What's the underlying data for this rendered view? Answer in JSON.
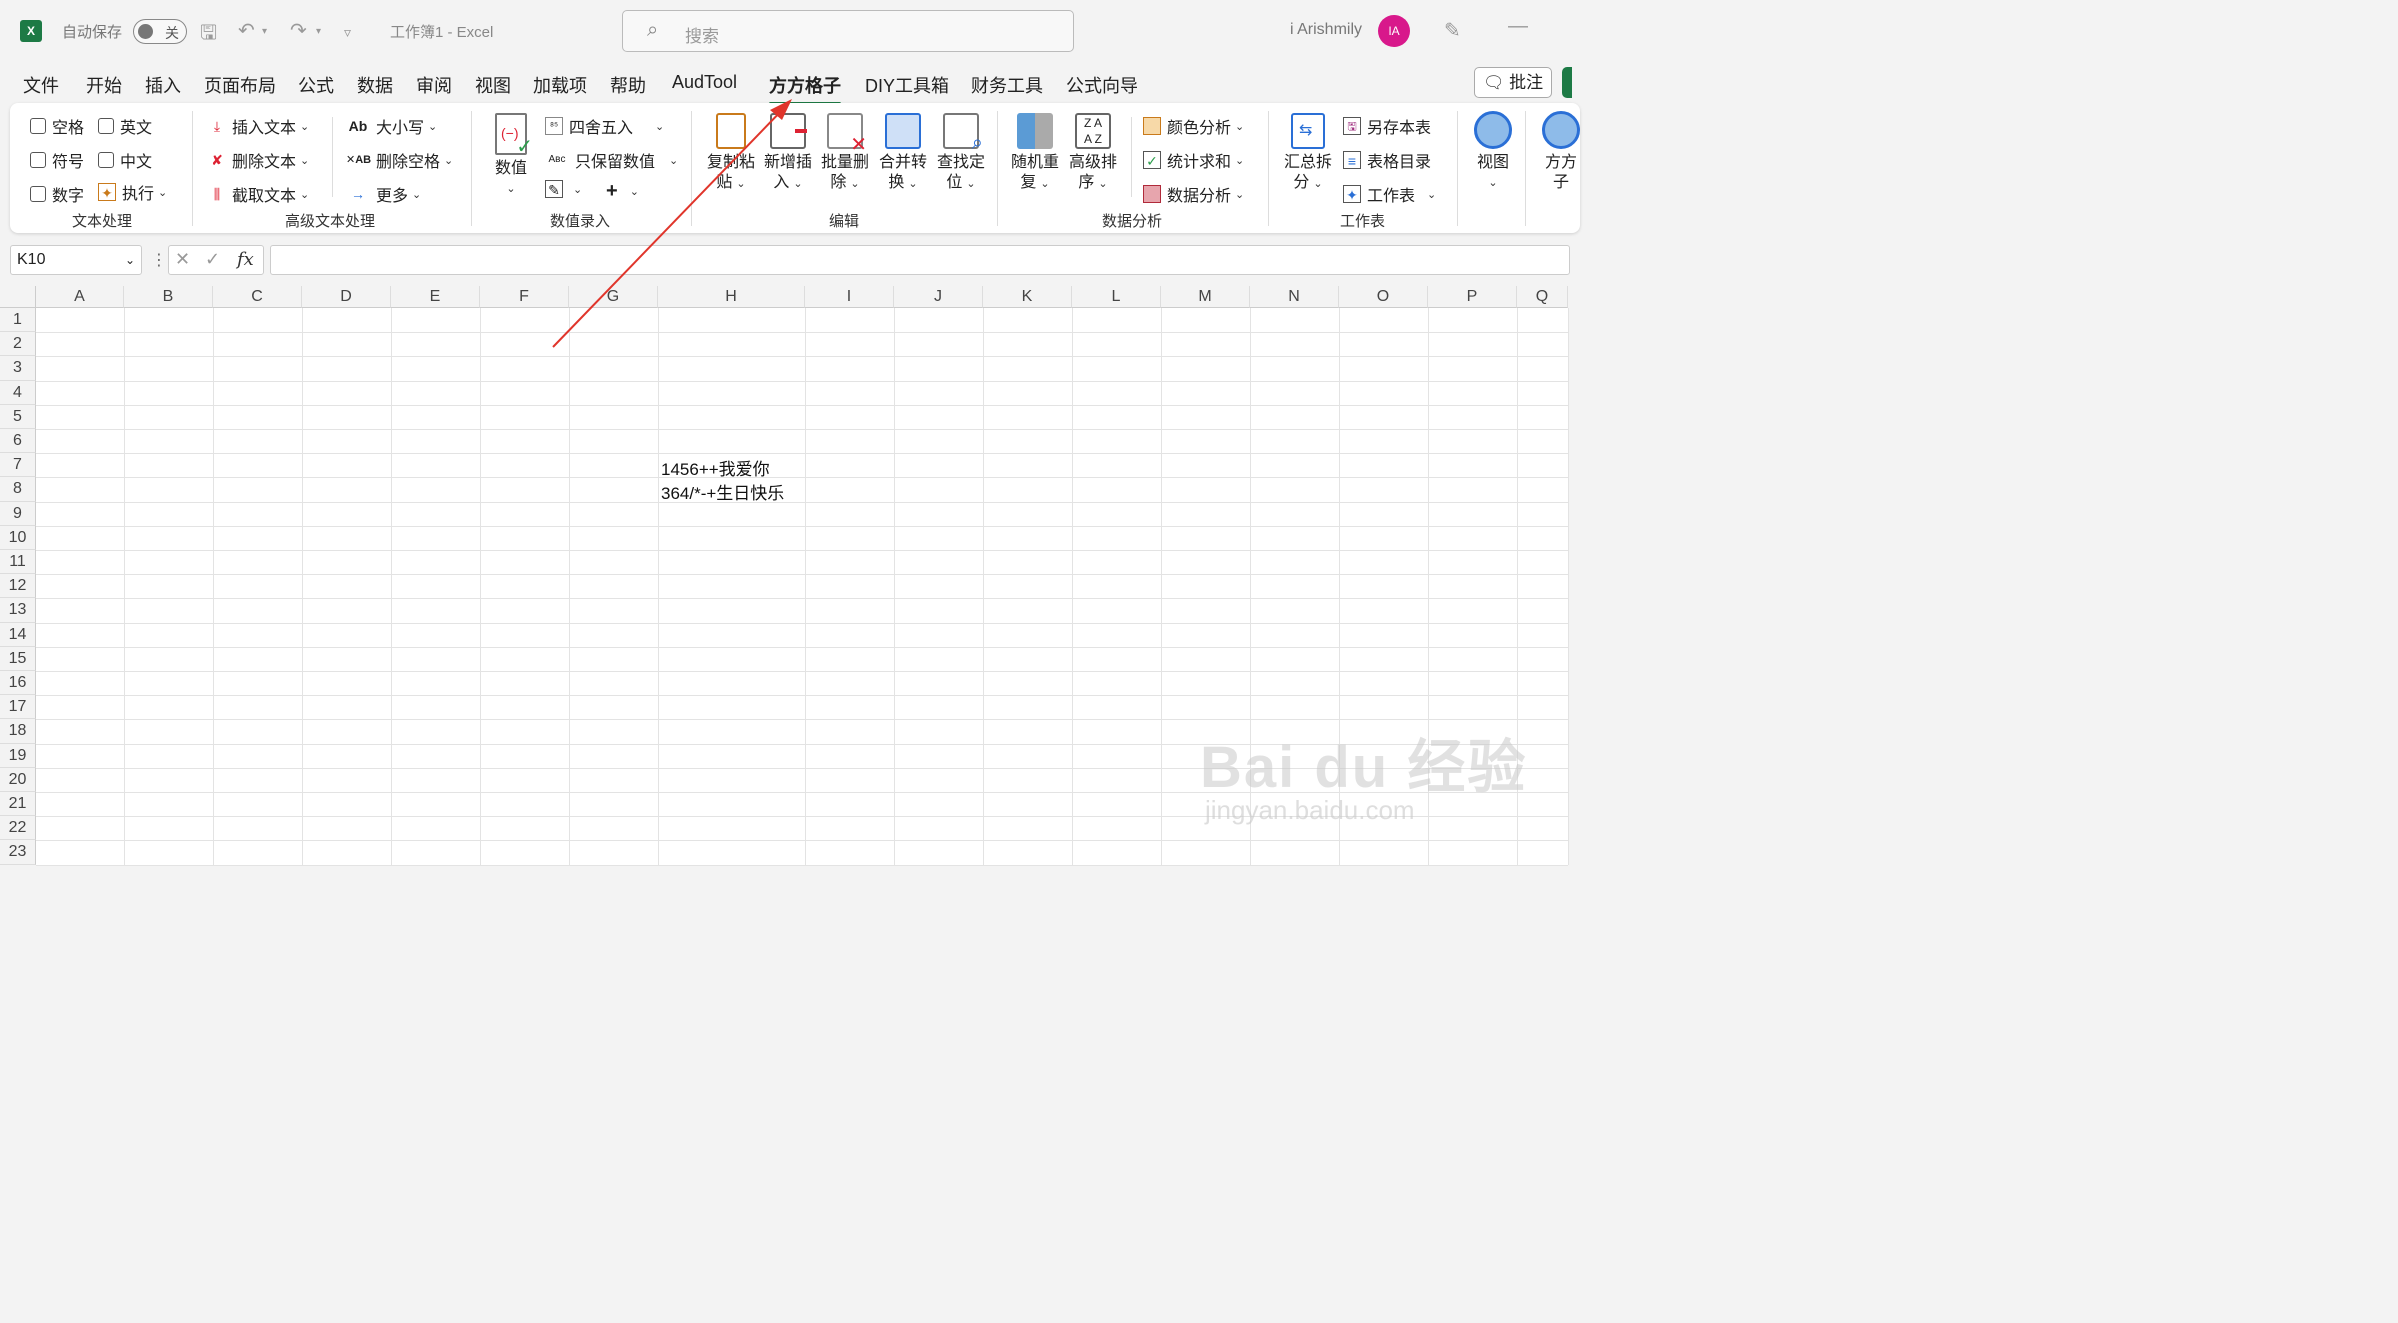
{
  "titlebar": {
    "logo": "X",
    "autosave_label": "自动保存",
    "autosave_state": "关",
    "doc_title": "工作簿1  -  Excel",
    "search_placeholder": "搜索",
    "user_name": "i Arishmily",
    "avatar_initials": "IA"
  },
  "menu": {
    "tabs": [
      "文件",
      "开始",
      "插入",
      "页面布局",
      "公式",
      "数据",
      "审阅",
      "视图",
      "加载项",
      "帮助",
      "AudTool",
      "方方格子",
      "DIY工具箱",
      "财务工具",
      "公式向导"
    ],
    "active_tab": "方方格子",
    "comment_label": "批注"
  },
  "ribbon": {
    "groups": [
      "文本处理",
      "高级文本处理",
      "数值录入",
      "编辑",
      "数据分析",
      "工作表"
    ],
    "text_processing": {
      "space": "空格",
      "english": "英文",
      "symbol": "符号",
      "chinese": "中文",
      "number": "数字",
      "execute": "执行"
    },
    "advanced_text": {
      "insert_text": "插入文本",
      "delete_text": "删除文本",
      "cut_text": "截取文本",
      "case": "大小写",
      "delete_space": "删除空格",
      "more": "更多"
    },
    "number_entry": {
      "value": "数值",
      "round": "四舍五入",
      "keep_value": "只保留数值",
      "plus": "+"
    },
    "edit": {
      "copy_paste_1": "复制粘",
      "copy_paste_2": "贴",
      "new_insert_1": "新增插",
      "new_insert_2": "入",
      "batch_delete_1": "批量删",
      "batch_delete_2": "除",
      "merge_convert_1": "合并转",
      "merge_convert_2": "换",
      "find_locate_1": "查找定",
      "find_locate_2": "位"
    },
    "data_analysis": {
      "random_1": "随机重",
      "random_2": "复",
      "sort_1": "高级排",
      "sort_2": "序",
      "color_analysis": "颜色分析",
      "stat_sum": "统计求和",
      "data_analysis": "数据分析"
    },
    "worksheet": {
      "summary_1": "汇总拆",
      "summary_2": "分",
      "save_as": "另存本表",
      "toc": "表格目录",
      "sheet": "工作表"
    },
    "view": {
      "view_label": "视图",
      "ff_1": "方方",
      "ff_2": "子"
    }
  },
  "formula_bar": {
    "name_box": "K10",
    "fx": "fx",
    "cancel": "✕",
    "confirm": "✓"
  },
  "sheet": {
    "columns": [
      "A",
      "B",
      "C",
      "D",
      "E",
      "F",
      "G",
      "H",
      "I",
      "J",
      "K",
      "L",
      "M",
      "N",
      "O",
      "P",
      "Q"
    ],
    "rows": [
      "1",
      "2",
      "3",
      "4",
      "5",
      "6",
      "7",
      "8",
      "9",
      "10",
      "11",
      "12",
      "13",
      "14",
      "15",
      "16",
      "17",
      "18",
      "19",
      "20",
      "21",
      "22",
      "23"
    ],
    "cells": [
      {
        "ref": "H7",
        "text": "1456++我爱你"
      },
      {
        "ref": "H8",
        "text": "364/*-+生日快乐"
      }
    ]
  },
  "watermark": {
    "main": "Bai du 经验",
    "sub": "jingyan.baidu.com"
  },
  "colors": {
    "accent": "#1d7a45",
    "avatar": "#d8188b",
    "arrow": "#e0352b"
  }
}
